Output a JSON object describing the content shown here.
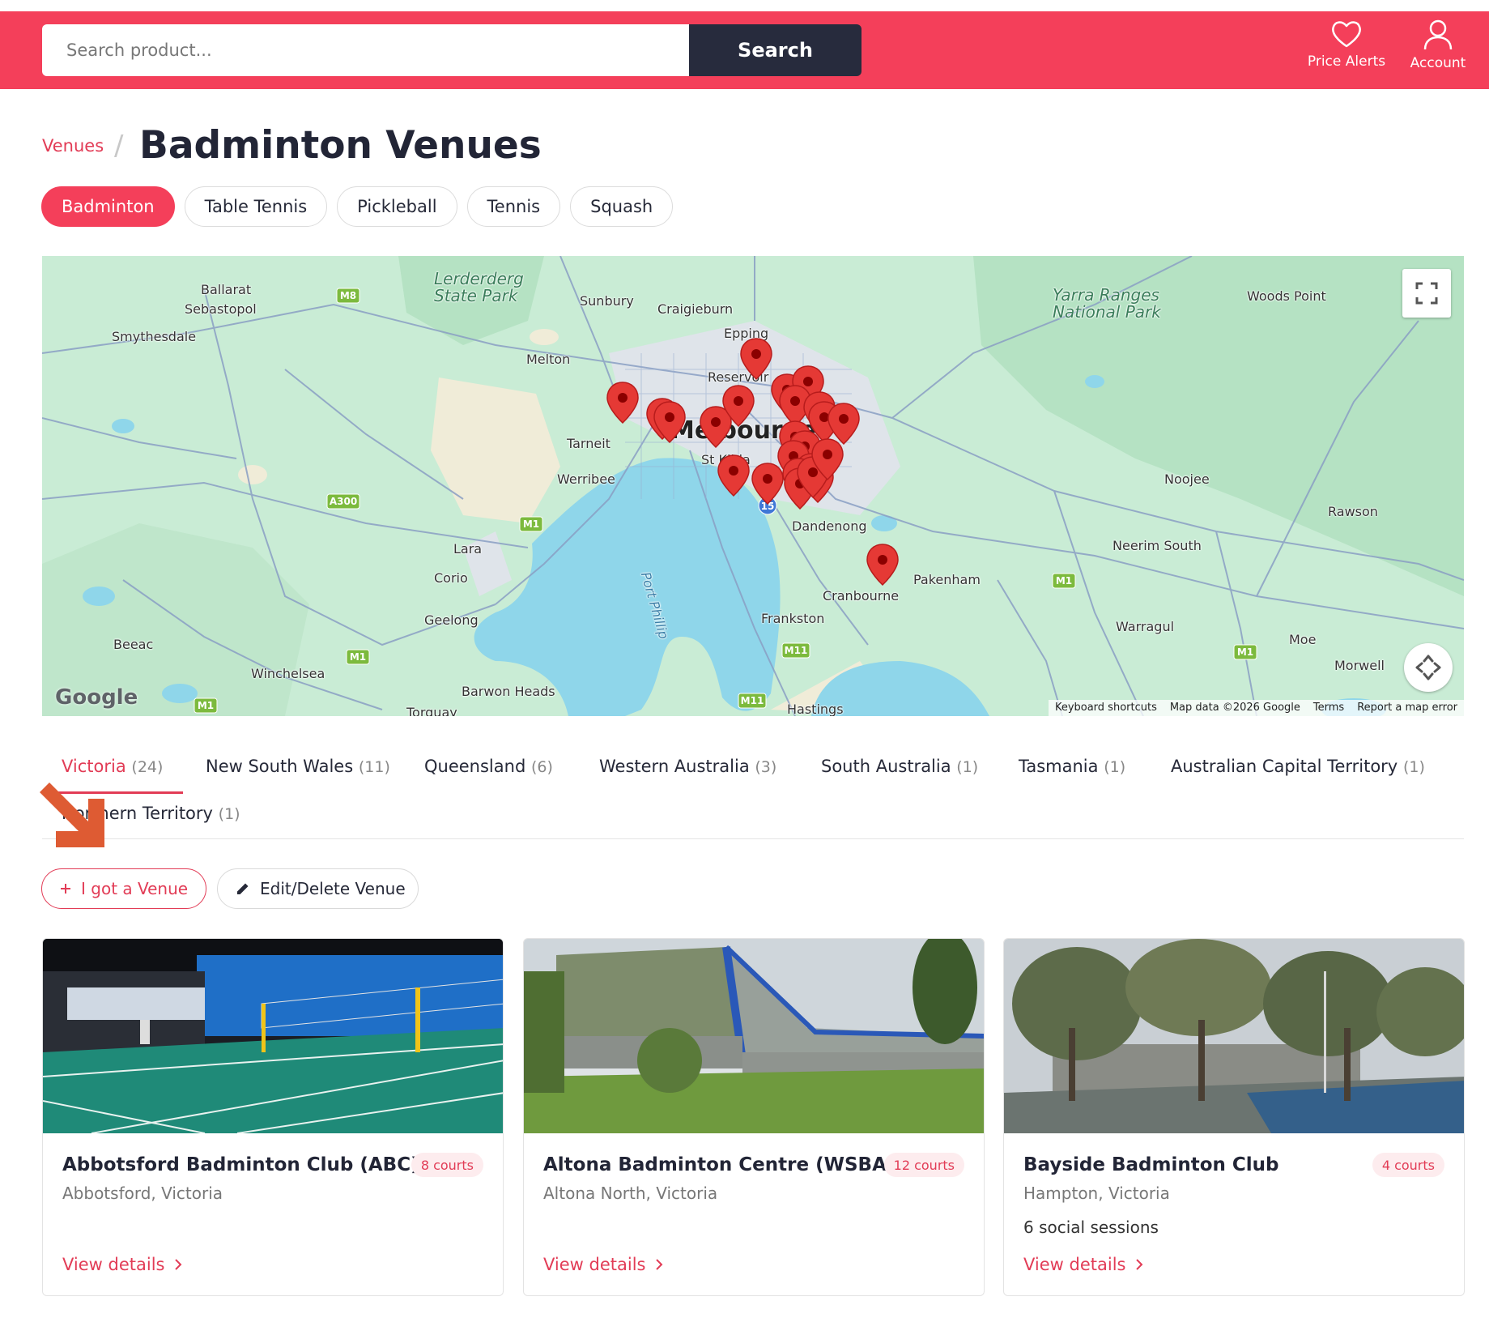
{
  "header": {
    "search_placeholder": "Search product...",
    "search_button": "Search",
    "price_alerts": "Price Alerts",
    "account": "Account"
  },
  "breadcrumb": {
    "parent": "Venues",
    "separator": "/"
  },
  "page_title": "Badminton Venues",
  "sports": [
    "Badminton",
    "Table Tennis",
    "Pickleball",
    "Tennis",
    "Squash"
  ],
  "active_sport": "Badminton",
  "map": {
    "places": [
      "Ballarat",
      "Sebastopol",
      "Smythesdale",
      "Lerderderg State Park",
      "Sunbury",
      "Craigieburn",
      "Epping",
      "Melton",
      "Reservoir",
      "Melbourne",
      "Tarneit",
      "Werribee",
      "St Kilda",
      "Dandenong",
      "Lara",
      "Corio",
      "Geelong",
      "Frankston",
      "Cranbourne",
      "Pakenham",
      "Beeac",
      "Winchelsea",
      "Barwon Heads",
      "Torquay",
      "Hastings",
      "Yarra Ranges National Park",
      "Woods Point",
      "Noojee",
      "Rawson",
      "Neerim South",
      "Warragul",
      "Moe",
      "Morwell",
      "Port Phillip"
    ],
    "road_labels": [
      "M8",
      "A300",
      "M1",
      "M11",
      "15"
    ],
    "logo": "Google",
    "footer": [
      "Keyboard shortcuts",
      "Map data ©2026 Google",
      "Terms",
      "Report a map error"
    ]
  },
  "states": [
    {
      "name": "Victoria",
      "count": "(24)"
    },
    {
      "name": "New South Wales",
      "count": "(11)"
    },
    {
      "name": "Queensland",
      "count": "(6)"
    },
    {
      "name": "Western Australia",
      "count": "(3)"
    },
    {
      "name": "South Australia",
      "count": "(1)"
    },
    {
      "name": "Tasmania",
      "count": "(1)"
    },
    {
      "name": "Australian Capital Territory",
      "count": "(1)"
    },
    {
      "name": "Northern Territory",
      "count": "(1)"
    }
  ],
  "actions": {
    "add": "I got a Venue",
    "edit": "Edit/Delete Venue"
  },
  "venues": [
    {
      "name": "Abbotsford Badminton Club (ABC)",
      "courts": "8 courts",
      "location": "Abbotsford, Victoria",
      "sessions": "",
      "link": "View details"
    },
    {
      "name": "Altona Badminton Centre (WSBA)",
      "courts": "12 courts",
      "location": "Altona North, Victoria",
      "sessions": "",
      "link": "View details"
    },
    {
      "name": "Bayside Badminton Club",
      "courts": "4 courts",
      "location": "Hampton, Victoria",
      "sessions": "6 social sessions",
      "link": "View details"
    }
  ],
  "colors": {
    "brand": "#f43f5a",
    "dark": "#272b3d",
    "accent_text": "#e23c56"
  }
}
